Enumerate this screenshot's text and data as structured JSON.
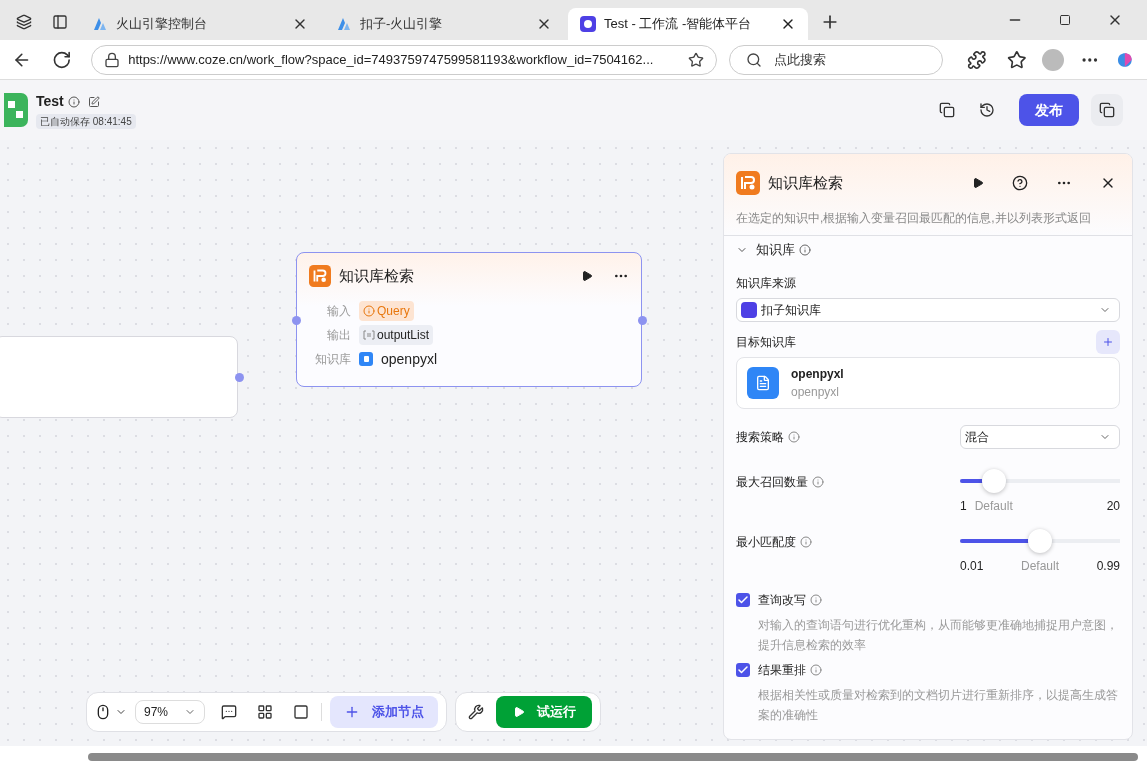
{
  "browser": {
    "tabs": [
      {
        "title": "火山引擎控制台",
        "selected": false
      },
      {
        "title": "扣子-火山引擎",
        "selected": false
      },
      {
        "title": "Test - 工作流 -智能体平台",
        "selected": true
      }
    ],
    "url": "https://www.coze.cn/work_flow?space_id=7493759747599581193&workflow_id=7504162...",
    "search_placeholder": "点此搜索"
  },
  "header": {
    "title": "Test",
    "autosave": "已自动保存 08:41:45",
    "publish": "发布"
  },
  "node": {
    "title": "知识库检索",
    "rows": [
      {
        "label": "输入",
        "value": "Query",
        "kind": "input"
      },
      {
        "label": "输出",
        "value": "outputList",
        "kind": "output"
      },
      {
        "label": "知识库",
        "value": "openpyxl",
        "kind": "knowledge"
      }
    ]
  },
  "panel": {
    "title": "知识库检索",
    "description": "在选定的知识中,根据输入变量召回最匹配的信息,并以列表形式返回",
    "section": {
      "title": "知识库",
      "expanded": true
    },
    "source_label": "知识库来源",
    "source_value": "扣子知识库",
    "target_label": "目标知识库",
    "target": {
      "name": "openpyxl",
      "sub": "openpyxl"
    },
    "strategy_label": "搜索策略",
    "strategy_value": "混合",
    "sliders": [
      {
        "label": "最大召回数量",
        "level": 0.21,
        "min": "1",
        "default": "Default",
        "max": "20"
      },
      {
        "label": "最小匹配度",
        "level": 0.5,
        "min": "0.01",
        "default": "Default",
        "max": "0.99"
      }
    ],
    "options": [
      {
        "label": "查询改写",
        "checked": true,
        "description": "对输入的查询语句进行优化重构，从而能够更准确地捕捉用户意图，提升信息检索的效率"
      },
      {
        "label": "结果重排",
        "checked": true,
        "description": "根据相关性或质量对检索到的文档切片进行重新排序，以提高生成答案的准确性"
      }
    ]
  },
  "toolbar": {
    "zoom": "97%",
    "add_node": "添加节点",
    "test_run": "试运行"
  }
}
